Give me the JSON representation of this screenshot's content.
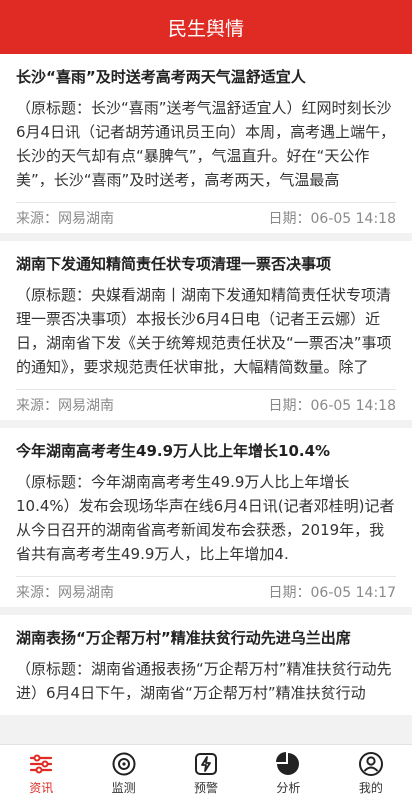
{
  "header": {
    "title": "民生舆情"
  },
  "articles": [
    {
      "title": "长沙“喜雨”及时送考高考两天气温舒适宜人",
      "summary": "（原标题：长沙“喜雨”送考气温舒适宜人）红网时刻长沙6月4日讯（记者胡芳通讯员王向）本周，高考遇上端午，长沙的天气却有点“暴脾气”，气温直升。好在“天公作美”，长沙“喜雨”及时送考，高考两天，气温最高",
      "source": "来源：网易湖南",
      "date": "日期：06-05 14:18"
    },
    {
      "title": "湖南下发通知精简责任状专项清理一票否决事项",
      "summary": "（原标题：央媒看湖南丨湖南下发通知精简责任状专项清理一票否决事项）本报长沙6月4日电（记者王云娜）近日，湖南省下发《关于统筹规范责任状及“一票否决”事项的通知》，要求规范责任状审批，大幅精简数量。除了",
      "source": "来源：网易湖南",
      "date": "日期：06-05 14:18"
    },
    {
      "title": "今年湖南高考考生49.9万人比上年增长10.4%",
      "summary": "（原标题：今年湖南高考考生49.9万人比上年增长10.4%）发布会现场华声在线6月4日讯(记者邓桂明)记者从今日召开的湖南省高考新闻发布会获悉，2019年，我省共有高考考生49.9万人，比上年增加4.",
      "source": "来源：网易湖南",
      "date": "日期：06-05 14:17"
    },
    {
      "title": "湖南表扬“万企帮万村”精准扶贫行动先进乌兰出席",
      "summary": "（原标题：湖南省通报表扬“万企帮万村”精准扶贫行动先进）6月4日下午，湖南省“万企帮万村”精准扶贫行动",
      "source": "",
      "date": ""
    }
  ],
  "tabs": [
    {
      "label": "资讯",
      "icon": "news-icon"
    },
    {
      "label": "监测",
      "icon": "monitor-icon"
    },
    {
      "label": "预警",
      "icon": "alert-icon"
    },
    {
      "label": "分析",
      "icon": "analysis-icon"
    },
    {
      "label": "我的",
      "icon": "profile-icon"
    }
  ],
  "colors": {
    "brand": "#e02b24",
    "meta_text": "#8a8a8a"
  }
}
